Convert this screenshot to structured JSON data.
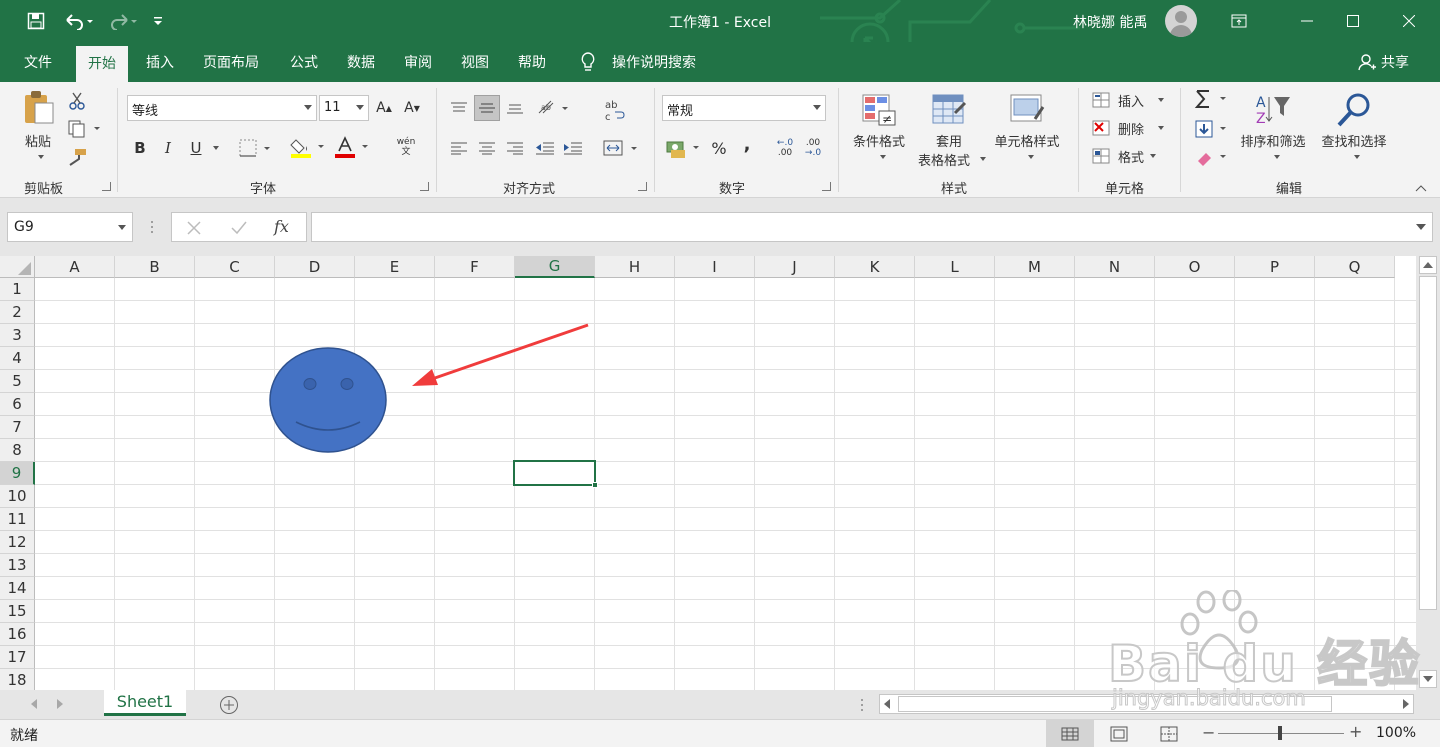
{
  "titlebar": {
    "title": "工作簿1  -  Excel",
    "user_name": "林晓娜 能禹"
  },
  "tabs": [
    "文件",
    "开始",
    "插入",
    "页面布局",
    "公式",
    "数据",
    "审阅",
    "视图",
    "帮助"
  ],
  "tell_me": "操作说明搜索",
  "share": "共享",
  "ribbon": {
    "clipboard": {
      "paste": "粘贴",
      "label": "剪贴板"
    },
    "font": {
      "name": "等线",
      "size": "11",
      "bold": "B",
      "italic": "I",
      "underline": "U",
      "grow": "A",
      "shrink": "A",
      "phonetic": "wén",
      "label": "字体"
    },
    "alignment": {
      "label": "对齐方式"
    },
    "number": {
      "format": "常规",
      "percent": "%",
      "comma": ",",
      "inc_decimal": ".00",
      "dec_decimal": ".0",
      "label": "数字"
    },
    "styles": {
      "conditional": "条件格式",
      "table_1": "套用",
      "table_2": "表格格式",
      "cell_styles": "单元格样式",
      "label": "样式"
    },
    "cells": {
      "insert": "插入",
      "delete": "删除",
      "format": "格式",
      "label": "单元格"
    },
    "editing": {
      "sort": "排序和筛选",
      "find": "查找和选择",
      "label": "编辑"
    }
  },
  "formula_bar": {
    "name_box": "G9",
    "fx": "fx",
    "value": ""
  },
  "columns": [
    "A",
    "B",
    "C",
    "D",
    "E",
    "F",
    "G",
    "H",
    "I",
    "J",
    "K",
    "L",
    "M",
    "N",
    "O",
    "P",
    "Q"
  ],
  "rows": [
    "1",
    "2",
    "3",
    "4",
    "5",
    "6",
    "7",
    "8",
    "9",
    "10",
    "11",
    "12",
    "13",
    "14",
    "15",
    "16",
    "17",
    "18"
  ],
  "selected_cell": {
    "column": "G",
    "row": "9"
  },
  "sheet_tabs": [
    "Sheet1"
  ],
  "status": {
    "ready": "就绪",
    "zoom": "100%"
  },
  "watermark": {
    "logo": "Bai du 经验",
    "url": "jingyan.baidu.com"
  },
  "colors": {
    "excel_green": "#217346",
    "shape_fill": "#4472c4",
    "arrow": "#f03c3c"
  }
}
